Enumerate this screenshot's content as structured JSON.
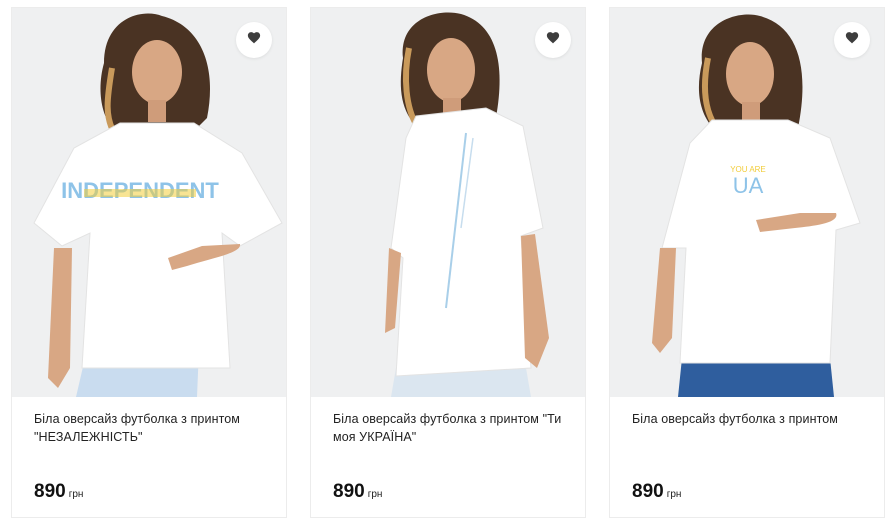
{
  "products": [
    {
      "title": "Біла оверсайз футболка з принтом \"НЕЗАЛЕЖНІСТЬ\"",
      "price": "890",
      "currency": "грн",
      "print_text": "INDEPENDENT"
    },
    {
      "title": "Біла оверсайз футболка з принтом \"Ти моя УКРАЇНА\"",
      "price": "890",
      "currency": "грн",
      "print_text": ""
    },
    {
      "title": "Біла оверсайз футболка з принтом",
      "price": "890",
      "currency": "грн",
      "print_text_top": "YOU ARE",
      "print_text_main": "UA"
    }
  ],
  "icons": {
    "favorite": "heart-icon"
  },
  "colors": {
    "print_blue": "#8ec3e8",
    "print_yellow": "#f2cd3b",
    "jeans": "#2f5e9e",
    "light_jeans": "#c9dcef"
  }
}
